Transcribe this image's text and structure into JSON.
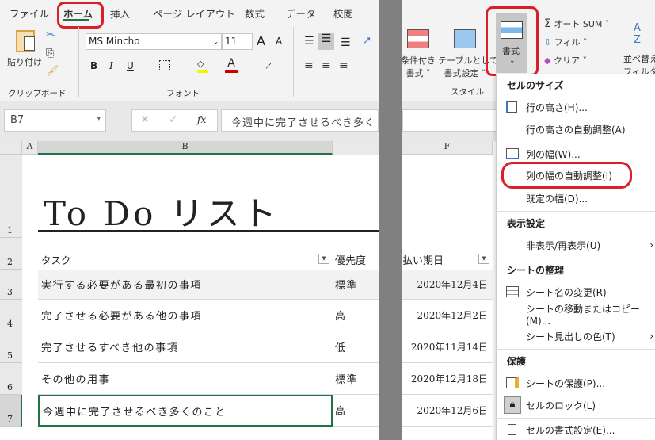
{
  "tabs": [
    "ファイル",
    "ホーム",
    "挿入",
    "ページ レイアウト",
    "数式",
    "データ",
    "校閲"
  ],
  "clipboard": {
    "paste": "貼り付け",
    "group": "クリップボード"
  },
  "font": {
    "name": "MS Mincho",
    "size": "11",
    "group": "フォント",
    "bold": "B",
    "italic": "I",
    "underline": "U",
    "grow": "A",
    "shrink": "A",
    "phonetic": "ア"
  },
  "styles": {
    "conditional": [
      "条件付き",
      "書式 ˅"
    ],
    "table": [
      "テーブルとして",
      "書式設定 ˅"
    ],
    "group": "スタイル"
  },
  "format_button": "書式",
  "editing": {
    "autosum": "オート SUM",
    "fill": "フィル",
    "clear": "クリア",
    "sort": [
      "並べ替え",
      "フィルター"
    ]
  },
  "formula_bar": {
    "name_box": "B7",
    "fx": "fx",
    "value": "今週中に完了させるべき多く"
  },
  "columns": [
    "A",
    "B",
    "F"
  ],
  "sheet": {
    "title": "To Do リスト",
    "headers": {
      "task": "タスク",
      "priority": "優先度",
      "due": "払い期日"
    },
    "rows": [
      {
        "num": "3",
        "task": "実行する必要がある最初の事項",
        "priority": "標準",
        "due": "2020年12月4日"
      },
      {
        "num": "4",
        "task": "完了させる必要がある他の事項",
        "priority": "高",
        "due": "2020年12月2日"
      },
      {
        "num": "5",
        "task": "完了させるすべき他の事項",
        "priority": "低",
        "due": "2020年11月14日"
      },
      {
        "num": "6",
        "task": "その他の用事",
        "priority": "標準",
        "due": "2020年12月18日"
      },
      {
        "num": "7",
        "task": "今週中に完了させるべき多くのこと",
        "priority": "高",
        "due": "2020年12月6日"
      }
    ],
    "row_numbers": [
      "1",
      "2"
    ]
  },
  "menu": {
    "cell_size": "セルのサイズ",
    "row_height": "行の高さ(H)...",
    "autofit_row": "行の高さの自動調整(A)",
    "col_width": "列の幅(W)...",
    "autofit_col": "列の幅の自動調整(I)",
    "default_width": "既定の幅(D)...",
    "visibility": "表示設定",
    "hide_unhide": "非表示/再表示(U)",
    "organize": "シートの整理",
    "rename": "シート名の変更(R)",
    "move_copy": "シートの移動またはコピー(M)...",
    "tab_color": "シート見出しの色(T)",
    "protection": "保護",
    "protect_sheet": "シートの保護(P)...",
    "lock_cell": "セルのロック(L)",
    "format_cells": "セルの書式設定(E)..."
  },
  "colors": {
    "accent": "#217346",
    "highlight": "#d7202a",
    "divider": "#808080"
  }
}
